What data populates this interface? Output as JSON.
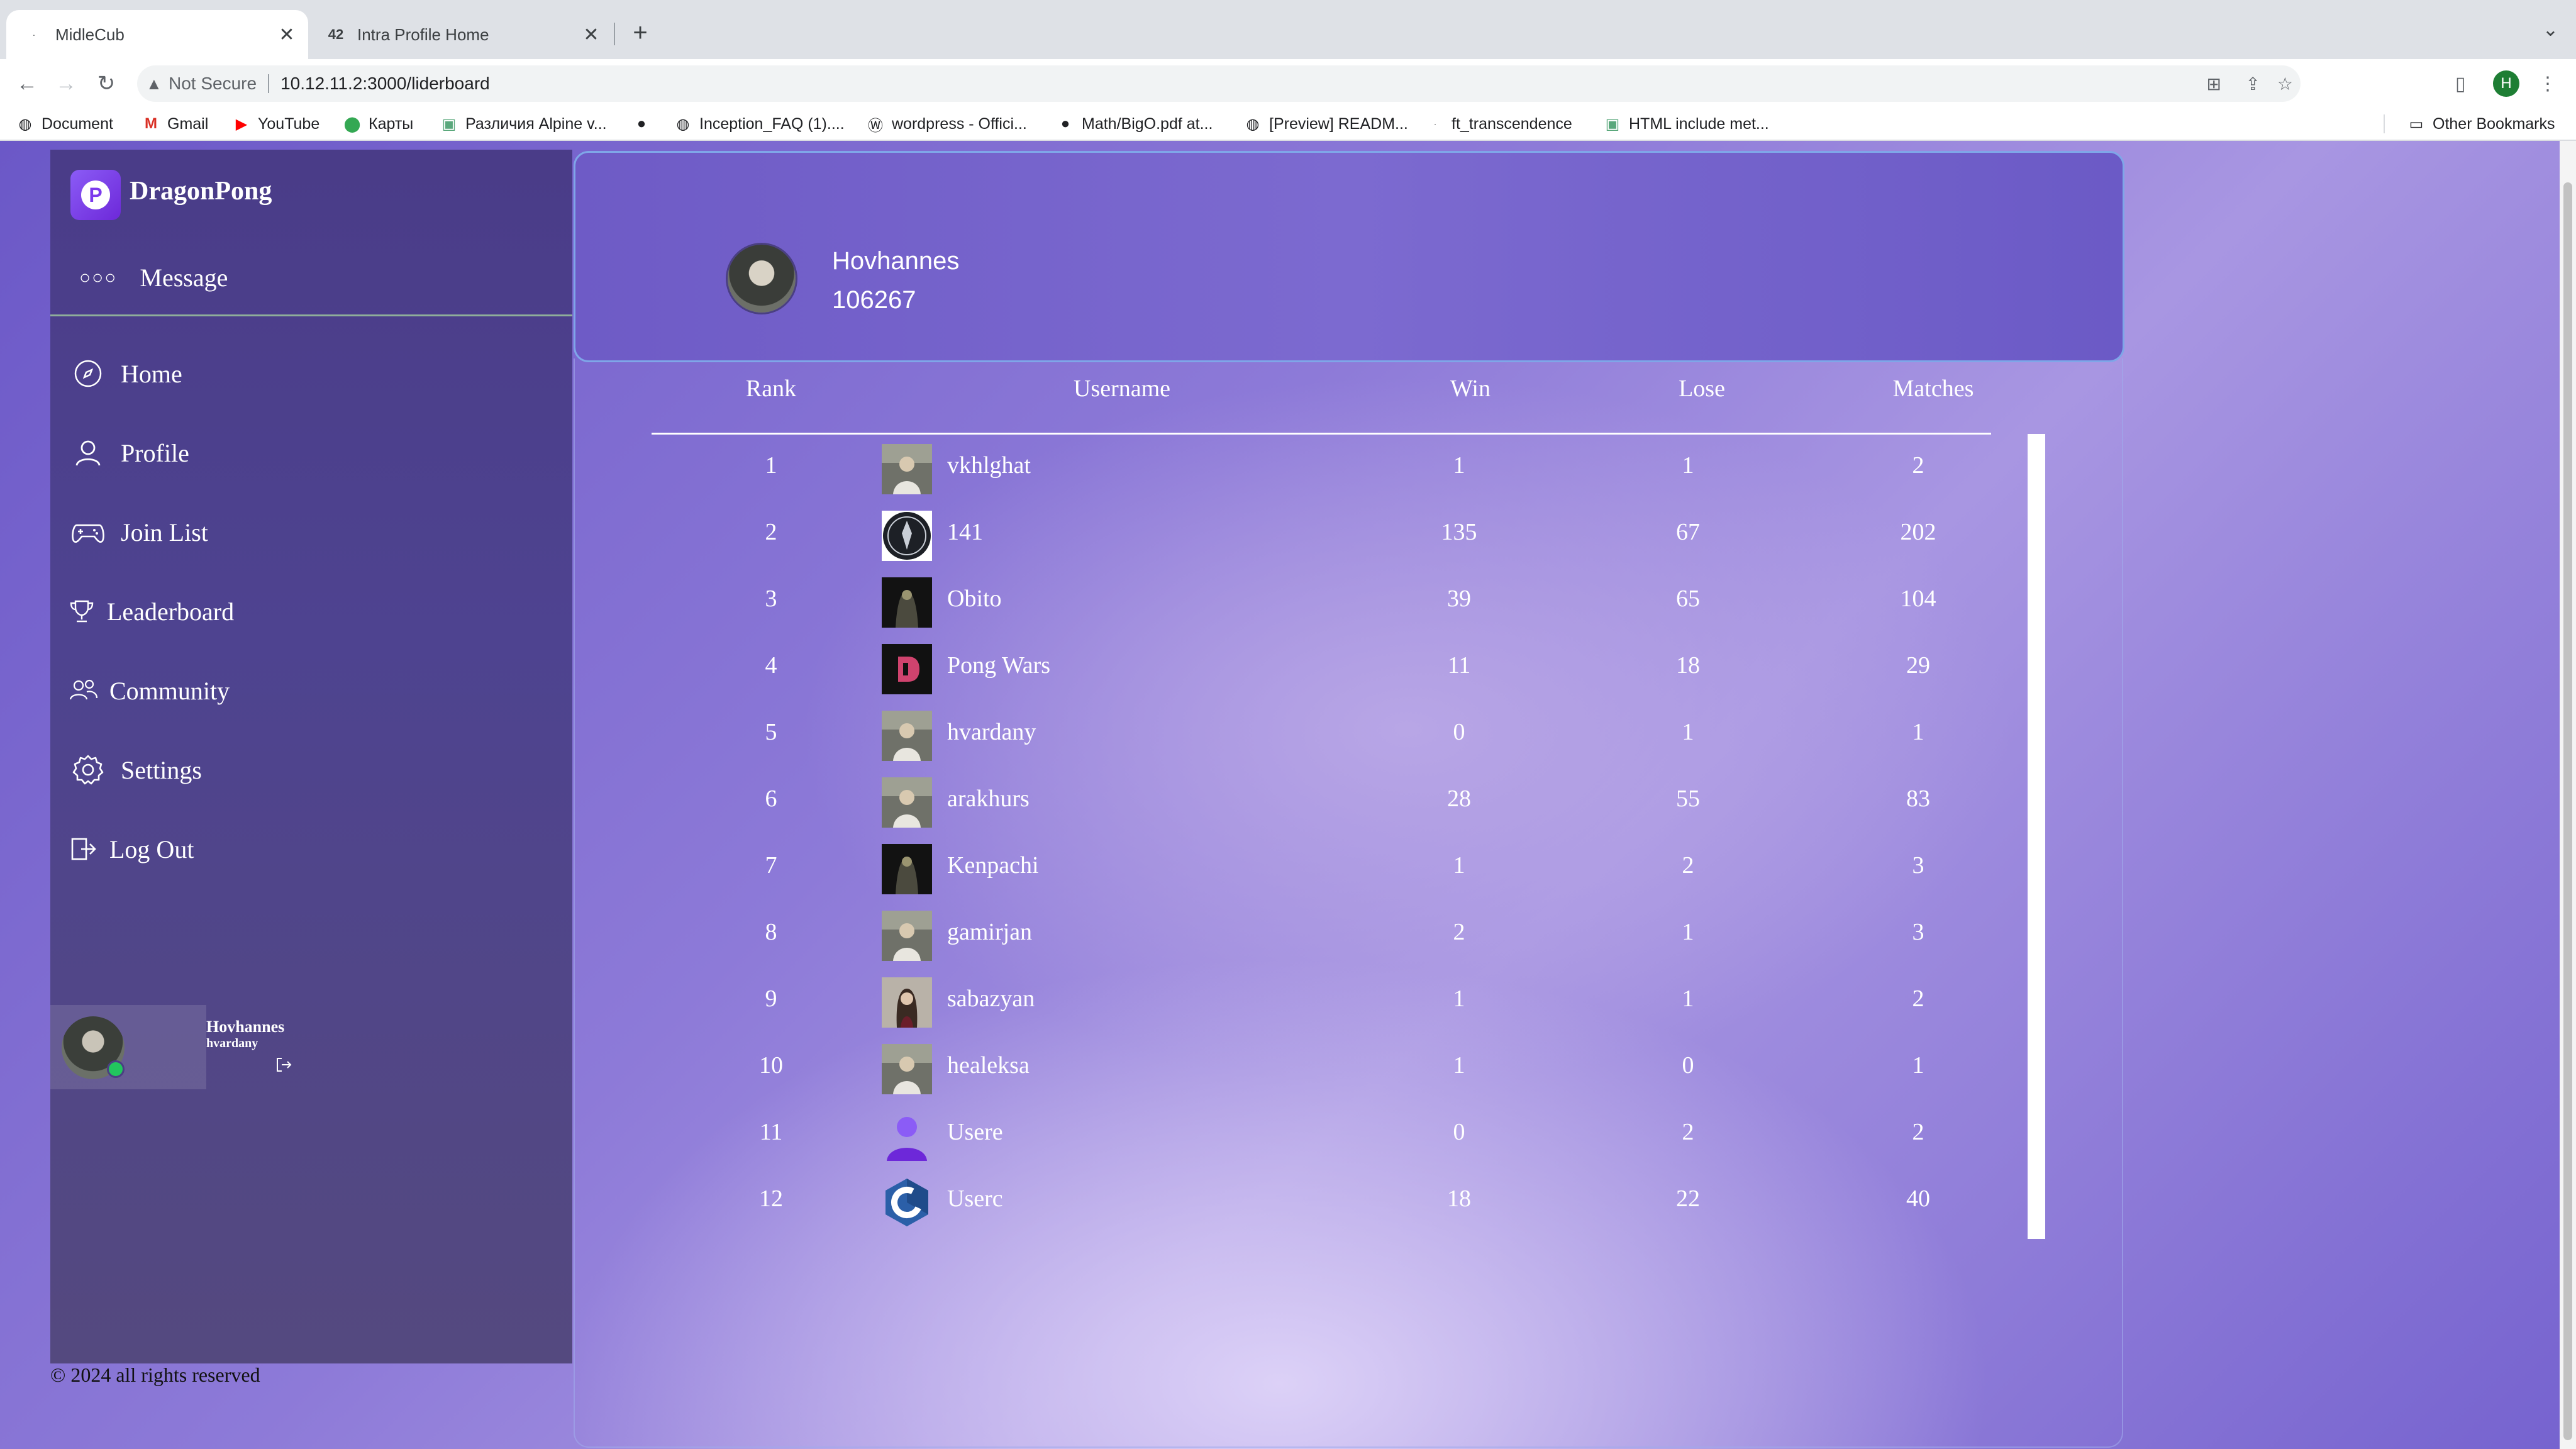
{
  "browser": {
    "tabs": [
      {
        "title": "MidleCub",
        "active": true
      },
      {
        "title": "Intra Profile Home",
        "active": false
      }
    ],
    "security_label": "Not Secure",
    "url": "10.12.11.2:3000/liderboard",
    "profile_initial": "H",
    "bookmarks": [
      {
        "label": "Document",
        "icon": "globe-icon"
      },
      {
        "label": "Gmail",
        "icon": "gmail-icon"
      },
      {
        "label": "YouTube",
        "icon": "youtube-icon"
      },
      {
        "label": "Карты",
        "icon": "maps-icon"
      },
      {
        "label": "Различия Alpine v...",
        "icon": "page-icon"
      },
      {
        "label": "",
        "icon": "github-icon"
      },
      {
        "label": "Inception_FAQ (1)....",
        "icon": "globe-icon"
      },
      {
        "label": "wordpress - Offici...",
        "icon": "wordpress-icon"
      },
      {
        "label": "Math/BigO.pdf at...",
        "icon": "github-icon"
      },
      {
        "label": "[Preview] READM...",
        "icon": "globe-icon"
      },
      {
        "label": "ft_transcendence",
        "icon": "dot-icon"
      },
      {
        "label": "HTML include met...",
        "icon": "page-icon"
      }
    ],
    "other_bookmarks": "Other Bookmarks"
  },
  "sidebar": {
    "brand": "DragonPong",
    "message": "Message",
    "nav": [
      {
        "label": "Home",
        "icon": "compass-icon"
      },
      {
        "label": "Profile",
        "icon": "user-icon"
      },
      {
        "label": "Join List",
        "icon": "gamepad-icon"
      },
      {
        "label": "Leaderboard",
        "icon": "trophy-icon"
      },
      {
        "label": "Community",
        "icon": "community-icon"
      },
      {
        "label": "Settings",
        "icon": "gear-icon"
      },
      {
        "label": "Log Out",
        "icon": "logout-icon"
      }
    ],
    "user": {
      "name": "Hovhannes",
      "login": "hvardany"
    }
  },
  "profile": {
    "name": "Hovhannes",
    "score": "106267"
  },
  "leaderboard": {
    "headers": {
      "rank": "Rank",
      "username": "Username",
      "win": "Win",
      "lose": "Lose",
      "matches": "Matches"
    },
    "rows": [
      {
        "rank": "1",
        "username": "vkhlghat",
        "win": "1",
        "lose": "1",
        "matches": "2",
        "avatar": "photo-man"
      },
      {
        "rank": "2",
        "username": "141",
        "win": "135",
        "lose": "67",
        "matches": "202",
        "avatar": "emblem"
      },
      {
        "rank": "3",
        "username": "Obito",
        "win": "39",
        "lose": "65",
        "matches": "104",
        "avatar": "dark-figure"
      },
      {
        "rank": "4",
        "username": "Pong Wars",
        "win": "11",
        "lose": "18",
        "matches": "29",
        "avatar": "pong-logo"
      },
      {
        "rank": "5",
        "username": "hvardany",
        "win": "0",
        "lose": "1",
        "matches": "1",
        "avatar": "photo-man"
      },
      {
        "rank": "6",
        "username": "arakhurs",
        "win": "28",
        "lose": "55",
        "matches": "83",
        "avatar": "photo-man"
      },
      {
        "rank": "7",
        "username": "Kenpachi",
        "win": "1",
        "lose": "2",
        "matches": "3",
        "avatar": "dark-figure"
      },
      {
        "rank": "8",
        "username": "gamirjan",
        "win": "2",
        "lose": "1",
        "matches": "3",
        "avatar": "photo-man"
      },
      {
        "rank": "9",
        "username": "sabazyan",
        "win": "1",
        "lose": "1",
        "matches": "2",
        "avatar": "photo-woman"
      },
      {
        "rank": "10",
        "username": "healeksa",
        "win": "1",
        "lose": "0",
        "matches": "1",
        "avatar": "photo-man"
      },
      {
        "rank": "11",
        "username": "Usere",
        "win": "0",
        "lose": "2",
        "matches": "2",
        "avatar": "default-user"
      },
      {
        "rank": "12",
        "username": "Userc",
        "win": "18",
        "lose": "22",
        "matches": "40",
        "avatar": "c-logo"
      }
    ]
  },
  "footer": "© 2024 all rights reserved",
  "colors": {
    "accent": "#7c3aed",
    "sidebar": "#4a3c88",
    "online": "#22c55e"
  }
}
